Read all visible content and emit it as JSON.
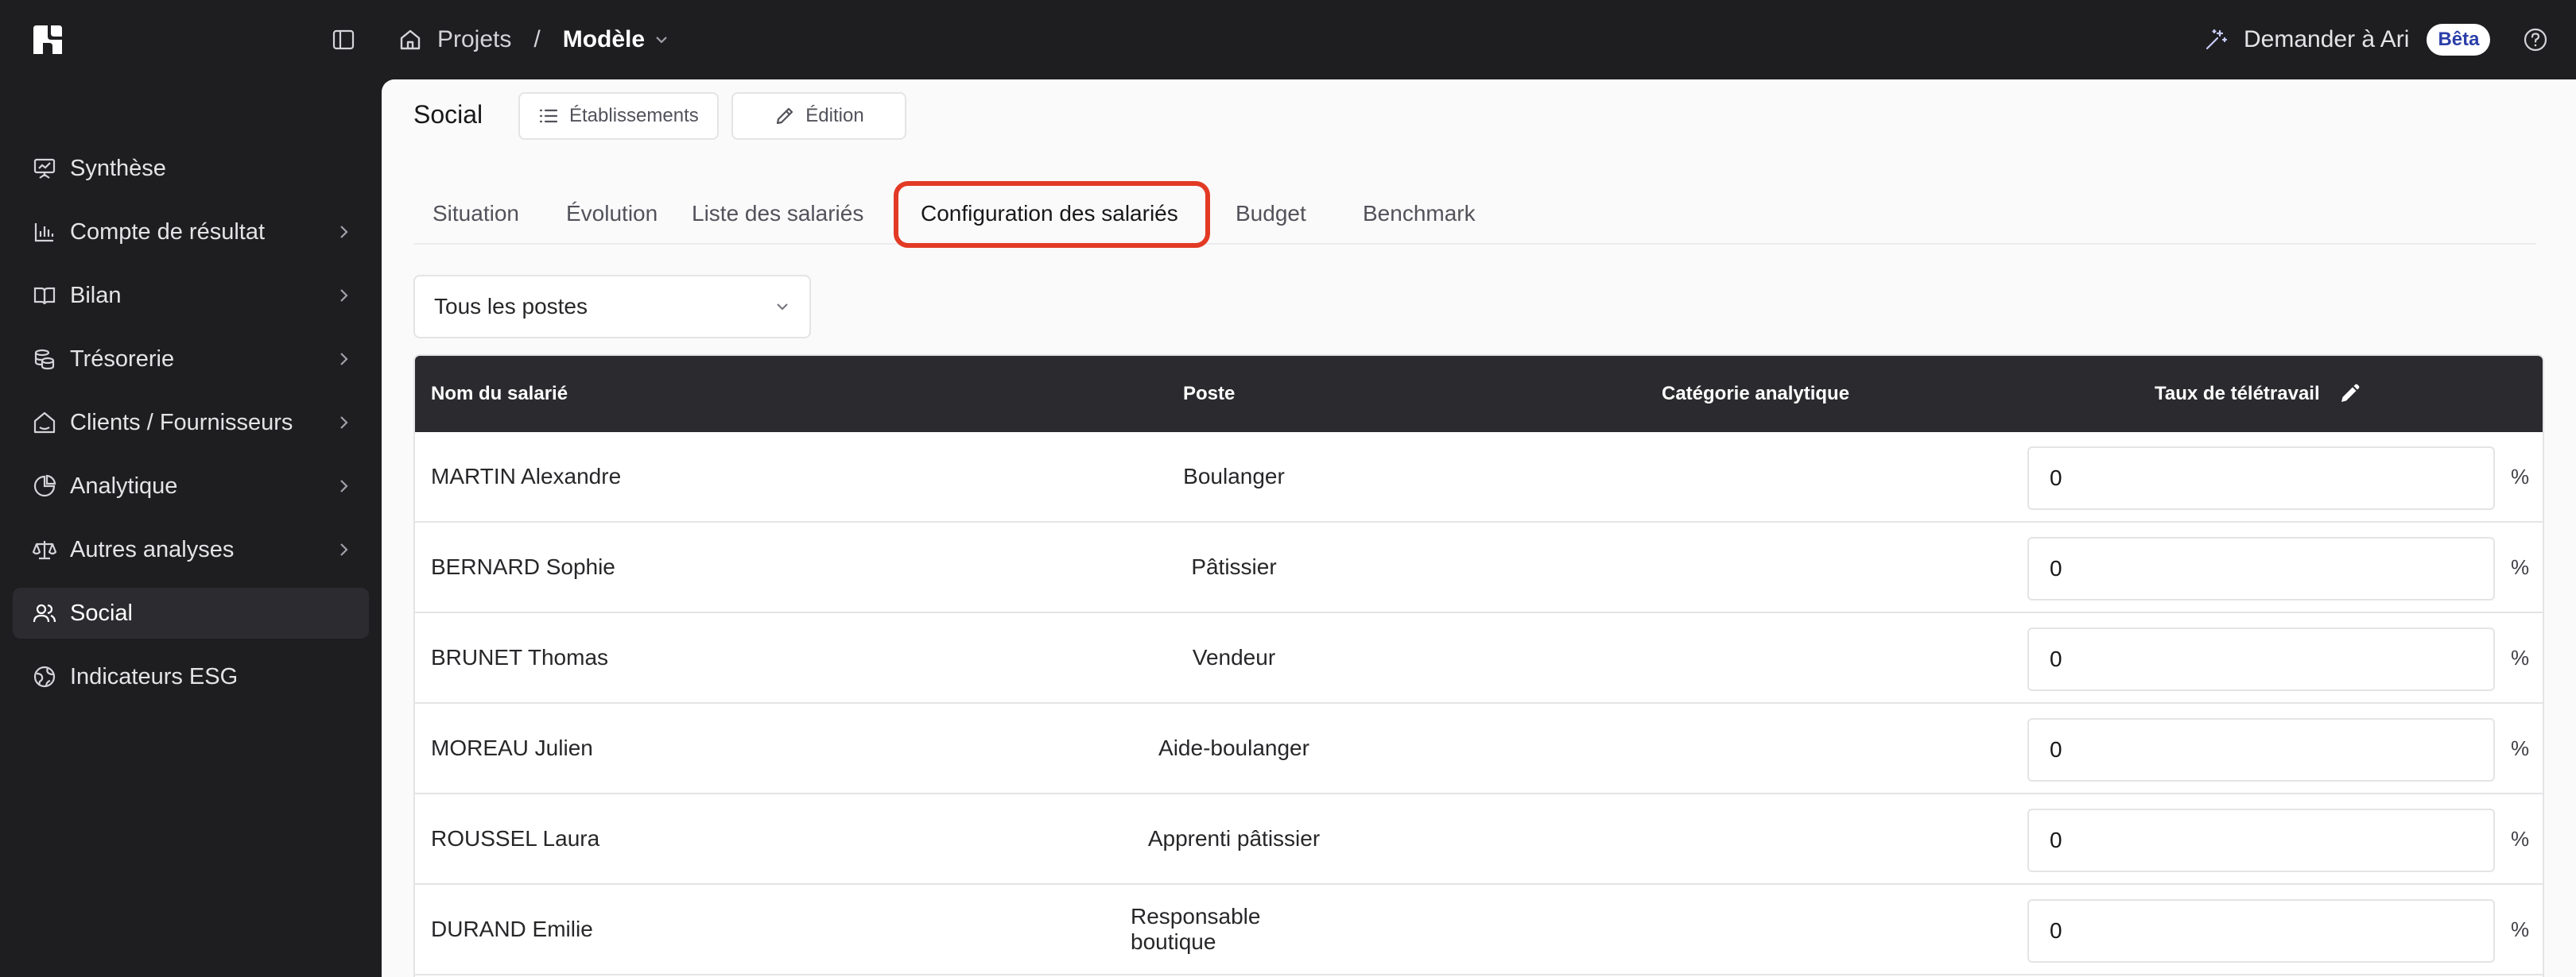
{
  "breadcrumb": {
    "root": "Projets",
    "separator": "/",
    "current": "Modèle"
  },
  "assistant": {
    "label": "Demander à Ari",
    "badge": "Bêta"
  },
  "sidebar": {
    "items": [
      {
        "label": "Synthèse",
        "icon": "presentation-icon",
        "arrow": false,
        "active": false
      },
      {
        "label": "Compte de résultat",
        "icon": "bar-chart-icon",
        "arrow": true,
        "active": false
      },
      {
        "label": "Bilan",
        "icon": "book-icon",
        "arrow": true,
        "active": false
      },
      {
        "label": "Trésorerie",
        "icon": "coins-icon",
        "arrow": true,
        "active": false
      },
      {
        "label": "Clients / Fournisseurs",
        "icon": "home-handshake-icon",
        "arrow": true,
        "active": false
      },
      {
        "label": "Analytique",
        "icon": "pie-chart-icon",
        "arrow": true,
        "active": false
      },
      {
        "label": "Autres analyses",
        "icon": "scale-icon",
        "arrow": true,
        "active": false
      },
      {
        "label": "Social",
        "icon": "users-icon",
        "arrow": false,
        "active": true
      },
      {
        "label": "Indicateurs ESG",
        "icon": "globe-icon",
        "arrow": false,
        "active": false
      }
    ]
  },
  "page": {
    "title": "Social",
    "buttons": {
      "establishments": "Établissements",
      "edition": "Édition"
    },
    "tabs": [
      {
        "label": "Situation"
      },
      {
        "label": "Évolution"
      },
      {
        "label": "Liste des salariés"
      },
      {
        "label": "Configuration des salariés"
      },
      {
        "label": "Budget"
      },
      {
        "label": "Benchmark"
      }
    ],
    "active_tab": "Configuration des salariés",
    "filter": {
      "value": "Tous les postes"
    }
  },
  "table": {
    "headers": {
      "name": "Nom du salarié",
      "poste": "Poste",
      "categorie": "Catégorie analytique",
      "teletravail": "Taux de télétravail"
    },
    "rows": [
      {
        "name": "MARTIN Alexandre",
        "poste": "Boulanger",
        "categorie": "",
        "taux": "0"
      },
      {
        "name": "BERNARD Sophie",
        "poste": "Pâtissier",
        "categorie": "",
        "taux": "0"
      },
      {
        "name": "BRUNET Thomas",
        "poste": "Vendeur",
        "categorie": "",
        "taux": "0"
      },
      {
        "name": "MOREAU Julien",
        "poste": "Aide-boulanger",
        "categorie": "",
        "taux": "0"
      },
      {
        "name": "ROUSSEL Laura",
        "poste": "Apprenti pâtissier",
        "categorie": "",
        "taux": "0"
      },
      {
        "name": "DURAND Emilie",
        "poste": "Responsable boutique",
        "categorie": "",
        "taux": "0"
      }
    ],
    "unit": "%"
  },
  "colors": {
    "sidebar_bg": "#1e1e21",
    "main_bg": "#fafafa",
    "table_header_bg": "#2b2b2f",
    "highlight": "#e23a25",
    "beta_text": "#2b3ea8"
  }
}
